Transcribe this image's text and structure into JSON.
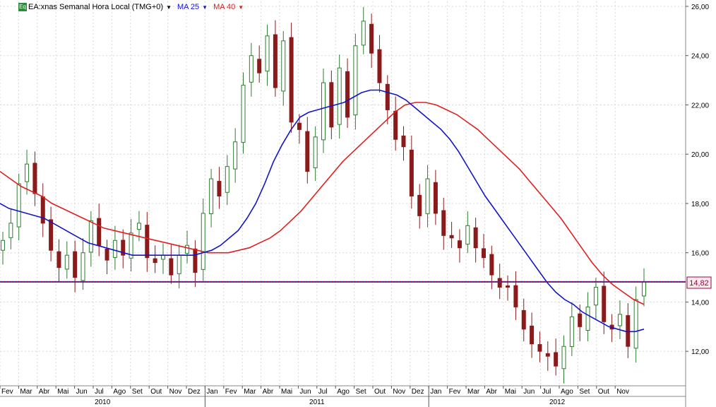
{
  "legend": {
    "symbol": "EA:xnas Semanal Hora Local (TMG+0)",
    "ma25_label": "MA 25",
    "ma40_label": "MA 40",
    "eq_icon_text": "Eq"
  },
  "colors": {
    "up_candle": "#2e7d32",
    "down_candle": "#8b1a1a",
    "ma25": "#1515c8",
    "ma40": "#e02020",
    "price_line": "#8b0a50",
    "price_dots": "#5a3fb0",
    "grid": "#d8d8d8"
  },
  "chart_data": {
    "type": "candlestick",
    "ylim": [
      10.6,
      26.2
    ],
    "y_ticks": [
      "12,00",
      "14,00",
      "16,00",
      "18,00",
      "20,00",
      "22,00",
      "24,00",
      "26,00"
    ],
    "month_labels": [
      "Fev",
      "Mar",
      "Abr",
      "Mai",
      "Jun",
      "Jul",
      "Ago",
      "Set",
      "Out",
      "Nov",
      "Dez",
      "Jan",
      "Fev",
      "Mar",
      "Abr",
      "Mai",
      "Jun",
      "Jul",
      "Ago",
      "Set",
      "Out",
      "Nov",
      "Dez",
      "Jan",
      "Fev",
      "Mar",
      "Abr",
      "Mai",
      "Jun",
      "Jul",
      "Ago",
      "Set",
      "Out",
      "Nov"
    ],
    "years": [
      "2010",
      "2011",
      "2012"
    ],
    "last_price": 14.82,
    "last_price_label": "14,82",
    "closes": [
      16.5,
      17.2,
      18.8,
      19.6,
      18.4,
      17.2,
      16.1,
      15.4,
      15.9,
      15.0,
      16.0,
      17.3,
      16.3,
      15.7,
      16.5,
      15.9,
      16.8,
      17.2,
      15.8,
      15.6,
      15.9,
      15.1,
      15.9,
      16.3,
      15.2,
      17.6,
      19.0,
      18.3,
      19.5,
      20.5,
      22.8,
      24.0,
      23.3,
      24.8,
      22.7,
      24.6,
      21.3,
      21.0,
      19.3,
      20.7,
      22.9,
      21.1,
      23.5,
      21.5,
      24.4,
      25.4,
      24.1,
      22.9,
      21.8,
      20.6,
      20.3,
      18.3,
      17.5,
      19.0,
      17.6,
      16.7,
      16.6,
      16.2,
      17.1,
      16.2,
      15.8,
      15.1,
      14.6,
      14.6,
      13.8,
      12.9,
      12.3,
      12.0,
      11.8,
      11.4,
      12.2,
      13.4,
      13.0,
      13.8,
      14.6,
      13.2,
      12.9,
      13.5,
      12.2,
      14.1,
      14.82
    ],
    "ma25": [
      18.0,
      17.8,
      17.7,
      17.6,
      17.5,
      17.4,
      17.2,
      17.0,
      16.8,
      16.6,
      16.4,
      16.3,
      16.2,
      16.1,
      16.0,
      15.9,
      15.9,
      15.9,
      15.9,
      15.9,
      15.9,
      15.9,
      15.9,
      16.0,
      16.1,
      16.3,
      16.6,
      16.9,
      17.4,
      18.0,
      18.8,
      19.7,
      20.4,
      21.0,
      21.5,
      21.7,
      21.8,
      21.9,
      22.0,
      22.1,
      22.3,
      22.5,
      22.6,
      22.6,
      22.5,
      22.4,
      22.2,
      21.9,
      21.6,
      21.3,
      21.0,
      20.6,
      20.1,
      19.5,
      18.9,
      18.3,
      17.8,
      17.3,
      16.8,
      16.3,
      15.8,
      15.3,
      14.8,
      14.4,
      14.1,
      13.9,
      13.6,
      13.4,
      13.2,
      13.0,
      12.9,
      12.8,
      12.8,
      12.9
    ],
    "ma40": [
      19.3,
      19.0,
      18.7,
      18.5,
      18.3,
      18.0,
      17.8,
      17.6,
      17.4,
      17.2,
      17.0,
      16.9,
      16.8,
      16.7,
      16.6,
      16.5,
      16.4,
      16.3,
      16.2,
      16.1,
      16.0,
      16.0,
      16.0,
      16.1,
      16.2,
      16.4,
      16.6,
      16.9,
      17.3,
      17.7,
      18.2,
      18.7,
      19.2,
      19.7,
      20.1,
      20.5,
      20.9,
      21.3,
      21.7,
      22.0,
      22.1,
      22.1,
      22.0,
      21.8,
      21.6,
      21.3,
      21.0,
      20.6,
      20.2,
      19.8,
      19.4,
      18.9,
      18.4,
      17.9,
      17.4,
      16.8,
      16.2,
      15.6,
      15.1,
      14.7,
      14.4,
      14.1,
      13.9
    ]
  }
}
